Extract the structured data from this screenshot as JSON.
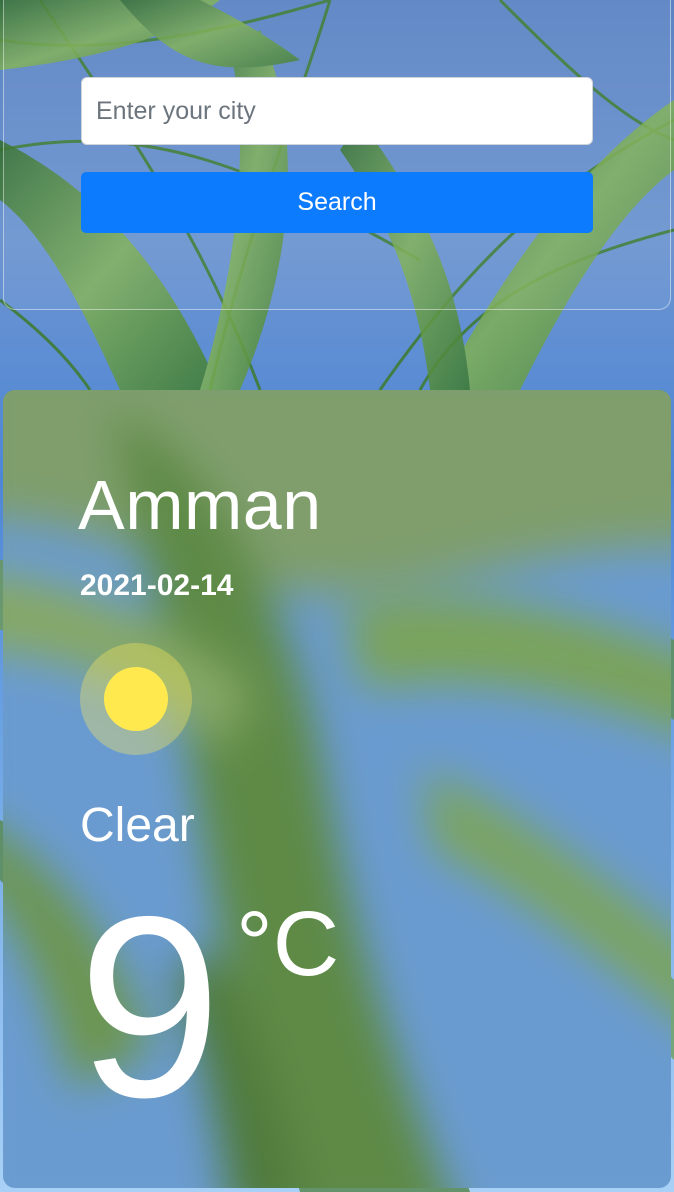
{
  "search": {
    "placeholder": "Enter your city",
    "value": "",
    "button_label": "Search"
  },
  "weather": {
    "city": "Amman",
    "date": "2021-02-14",
    "condition": "Clear",
    "condition_icon": "sun-icon",
    "temperature": "9",
    "unit": "°C"
  },
  "colors": {
    "primary_button": "#0d7bfd",
    "sun": "#ffe94f",
    "text": "#ffffff"
  }
}
